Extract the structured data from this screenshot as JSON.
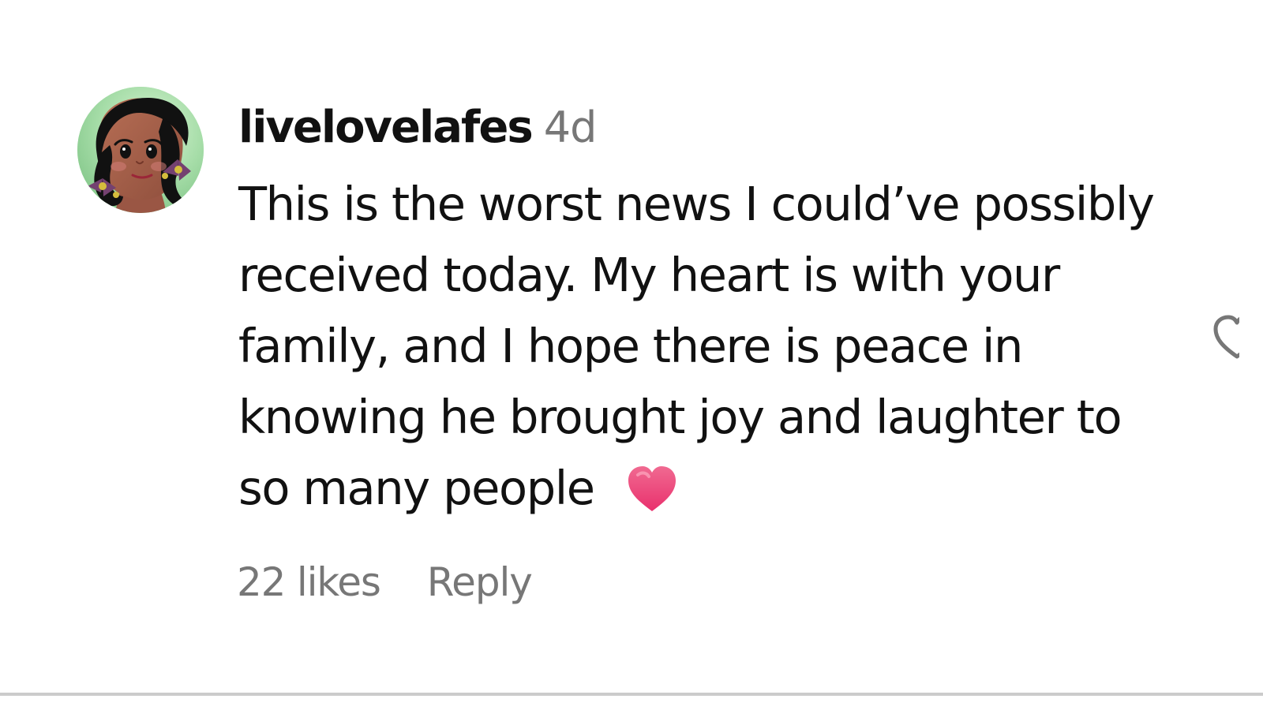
{
  "comment": {
    "username": "livelovelafes",
    "timestamp": "4d",
    "text": "This is the worst news I could’ve possibly received today. My heart is with your family, and I hope there is peace in knowing he brought joy and laughter to so many people",
    "emoji": "heart-icon",
    "likes": "22 likes",
    "reply_label": "Reply"
  },
  "icons": {
    "avatar": "avatar-illustration-icon",
    "like_action": "heart-outline-icon"
  },
  "colors": {
    "primary_text": "#111111",
    "secondary_text": "#777777",
    "heart": "#f04d86",
    "avatar_background": "#a7dfab"
  }
}
